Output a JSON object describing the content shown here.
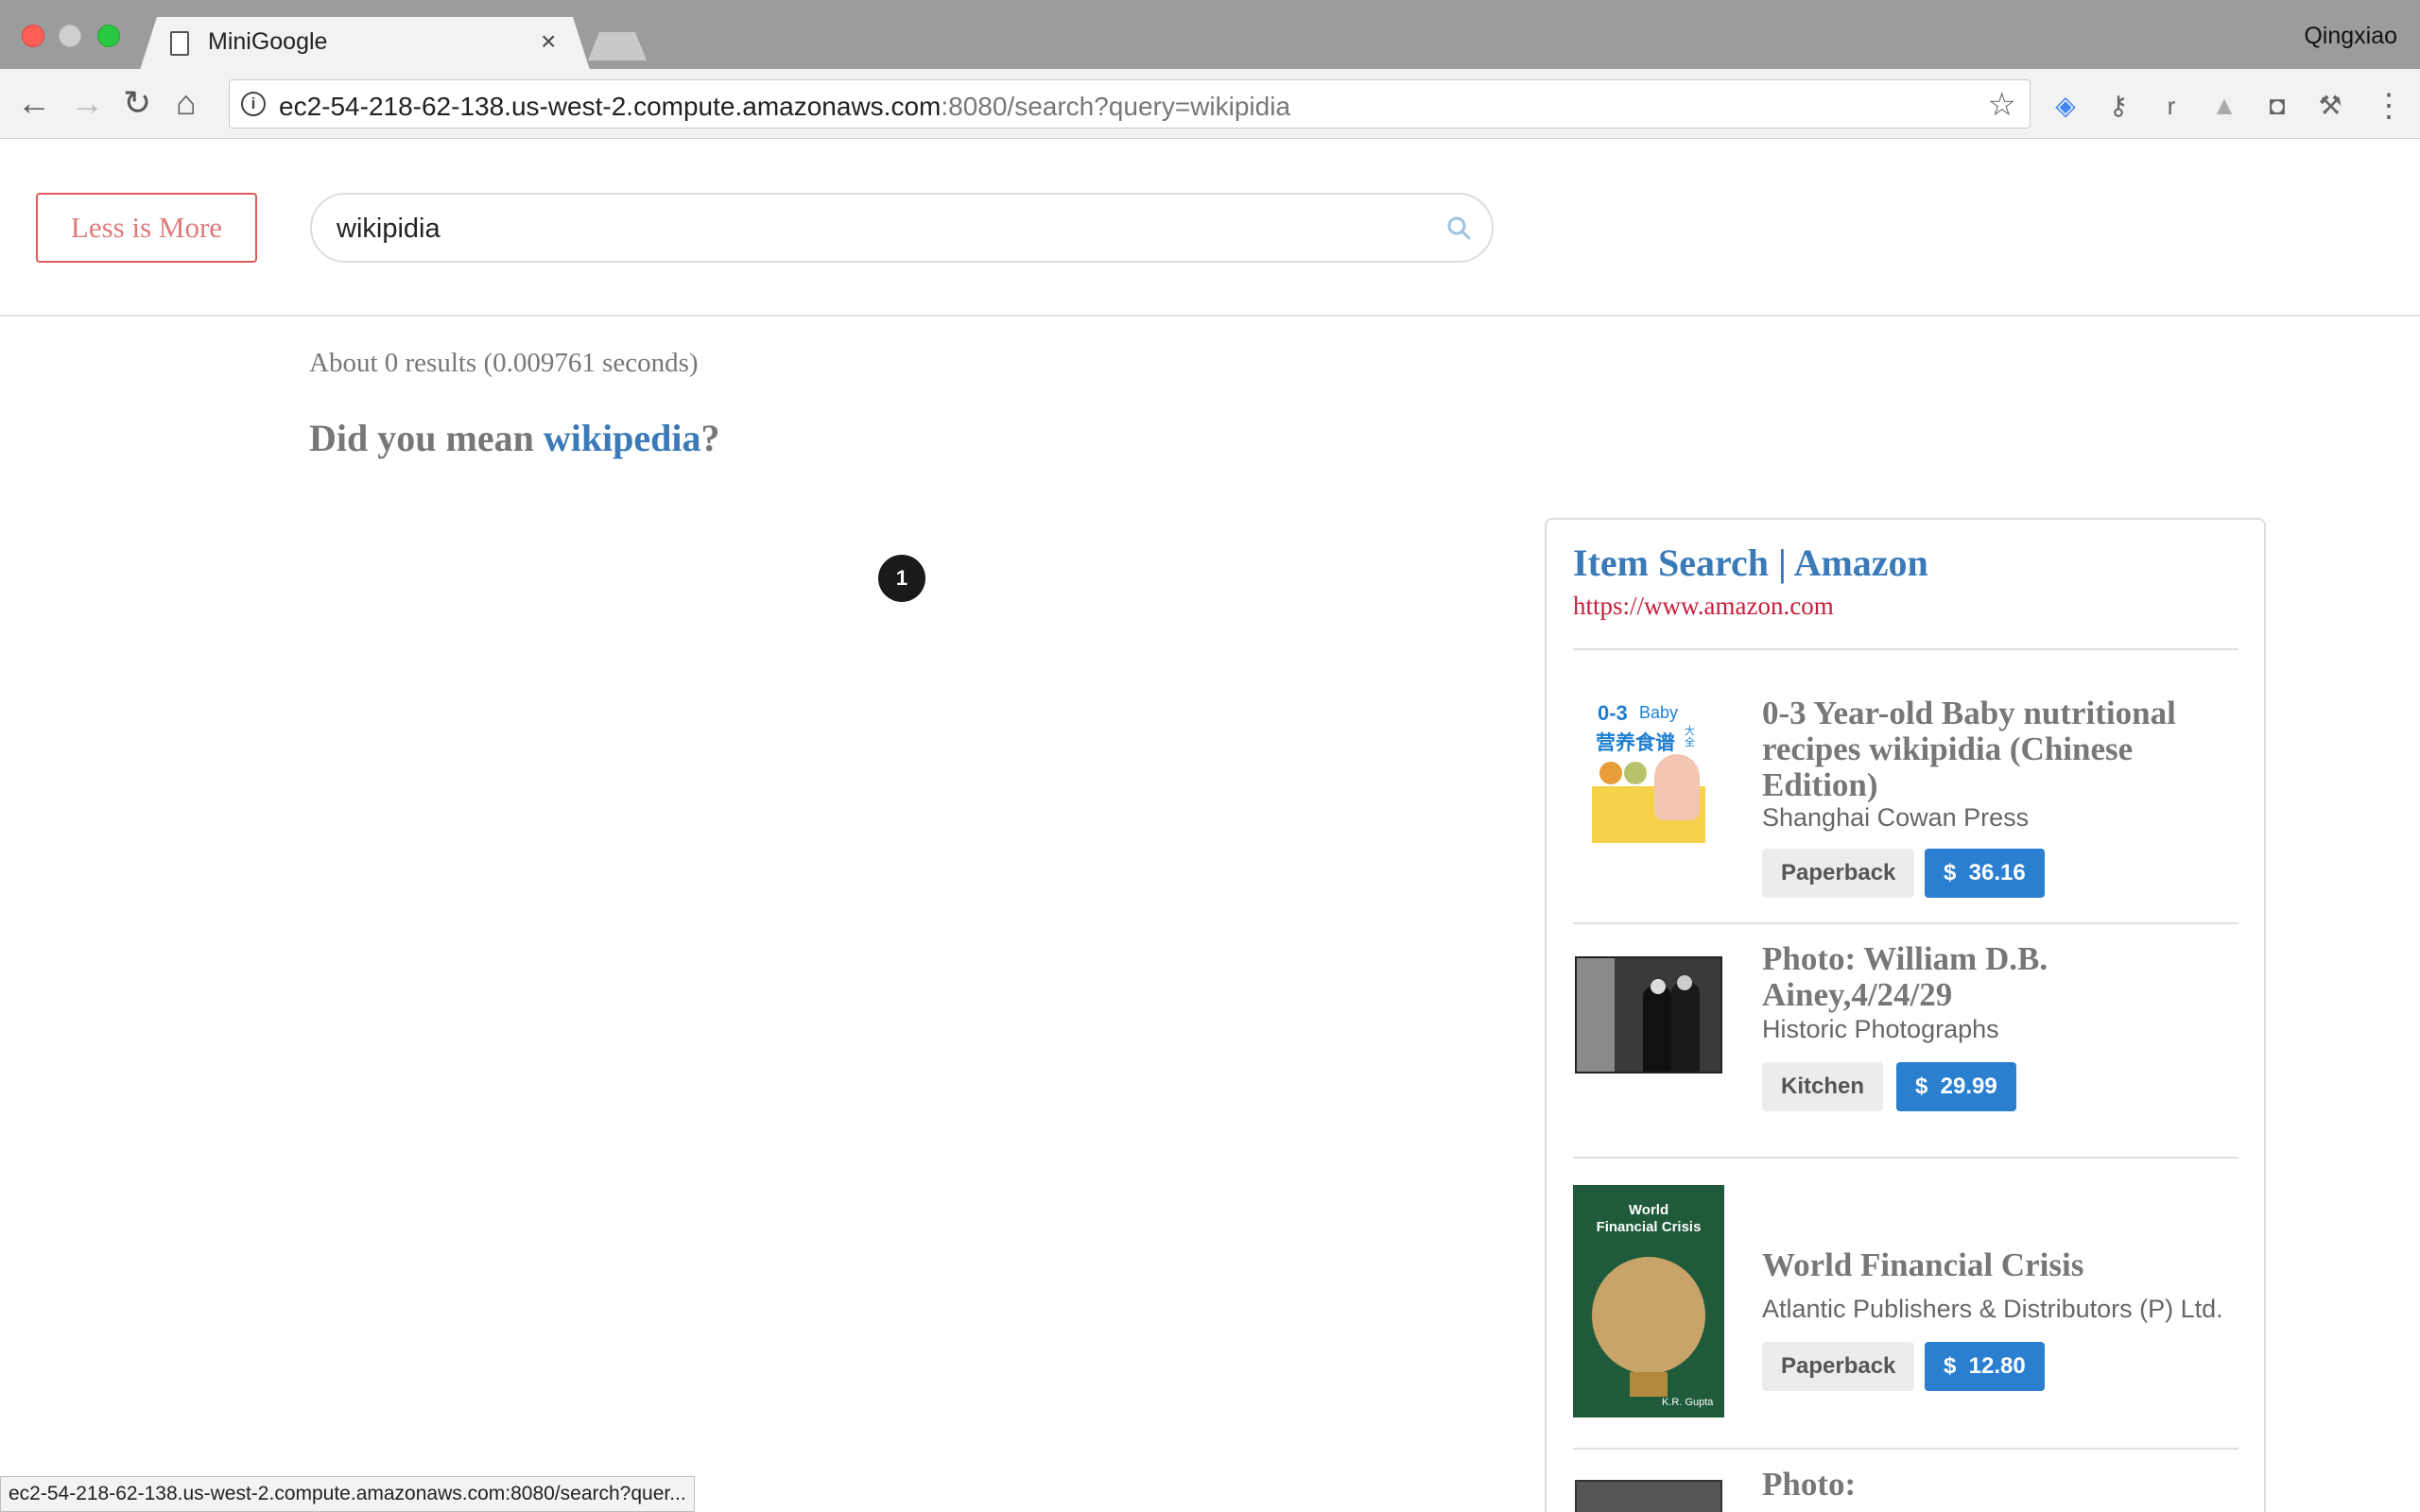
{
  "browser": {
    "tab_title": "MiniGoogle",
    "tab_close": "×",
    "profile_name": "Qingxiao",
    "url_host": "ec2-54-218-62-138.us-west-2.compute.amazonaws.com",
    "url_path": ":8080/search?query=wikipidia",
    "status_url": "ec2-54-218-62-138.us-west-2.compute.amazonaws.com:8080/search?quer..."
  },
  "header": {
    "logo": "Less is More",
    "search_value": "wikipidia"
  },
  "results": {
    "stats": "About 0 results (0.009761 seconds)",
    "did_you_mean_prefix": "Did you mean ",
    "suggestion": "wikipedia",
    "did_you_mean_suffix": "?",
    "page_number": "1"
  },
  "amazon": {
    "title": "Item Search | Amazon",
    "url": "https://www.amazon.com",
    "items": [
      {
        "title": "0-3 Year-old Baby nutritional recipes wikipidia (Chinese Edition)",
        "publisher": "Shanghai Cowan Press",
        "binding": "Paperback",
        "price": "$  36.16",
        "cover_text_1": "0-3",
        "cover_text_2": "Baby",
        "cover_text_3": "营养食谱",
        "cover_text_4": "大全"
      },
      {
        "title": "Photo: William D.B. Ainey,4/24/29",
        "publisher": "Historic Photographs",
        "binding": "Kitchen",
        "price": "$  29.99"
      },
      {
        "title": "World Financial Crisis",
        "publisher": "Atlantic Publishers & Distributors (P) Ltd.",
        "binding": "Paperback",
        "price": "$  12.80",
        "cover_text_1": "World",
        "cover_text_2": "Financial Crisis",
        "cover_text_3": "K.R. Gupta"
      },
      {
        "title": "Photo:"
      }
    ]
  },
  "colors": {
    "link_blue": "#3a7ab8",
    "price_blue": "#2a7fd0",
    "logo_red": "#e05a5a",
    "url_red": "#c51e3a"
  }
}
